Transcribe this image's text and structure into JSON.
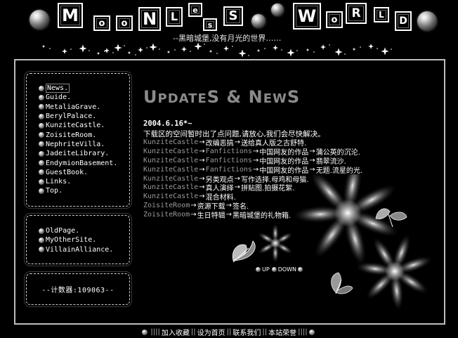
{
  "header": {
    "title_tiles": [
      "M",
      "o",
      "o",
      "N",
      "L",
      "e",
      "s",
      "S",
      "W",
      "o",
      "R",
      "L",
      "D"
    ],
    "tagline": "--黑暗城堡,没有月光的世界……"
  },
  "nav": {
    "items": [
      {
        "label": "News."
      },
      {
        "label": "Guide."
      },
      {
        "label": "MetaliaGrave."
      },
      {
        "label": "BerylPalace."
      },
      {
        "label": "KunziteCastle."
      },
      {
        "label": "ZoisiteRoom."
      },
      {
        "label": "NephriteVilla."
      },
      {
        "label": "JadeiteLibrary."
      },
      {
        "label": "EndymionBasement."
      },
      {
        "label": "GuestBook."
      },
      {
        "label": "Links."
      },
      {
        "label": "Top."
      }
    ],
    "secondary": [
      {
        "label": "OldPage."
      },
      {
        "label": "MyOtherSite."
      },
      {
        "label": "VillainAlliance."
      }
    ]
  },
  "counter": {
    "text": "--计数器:109063--"
  },
  "main": {
    "title_big_1": "U",
    "title_small_1": "PDATE",
    "title_big_2": "S & N",
    "title_small_2": "EW",
    "title_big_3": "S",
    "date": "2004.6.16*~",
    "note": "下载区的空间暂时出了点问题,请放心,我们会尽快解决。",
    "entries": [
      {
        "section": "KunziteCastle",
        "parts": [
          "改编恶搞",
          "送给真人版之古舒特."
        ]
      },
      {
        "section": "KunziteCastle",
        "parts": [
          "Fanfictions",
          "中国网友的作品",
          "蒲公英的沉沦."
        ]
      },
      {
        "section": "KunziteCastle",
        "parts": [
          "Fanfictions",
          "中国网友的作品",
          "翡翠流沙."
        ]
      },
      {
        "section": "KunziteCastle",
        "parts": [
          "Fanfictions",
          "中国网友的作品",
          "无题.流星的光."
        ]
      },
      {
        "section": "KunziteCastle",
        "parts": [
          "另类观点",
          "写作选择.母鸡和母猫."
        ]
      },
      {
        "section": "KunziteCastle",
        "parts": [
          "真人演绎",
          "拼贴图.拍摄花絮."
        ]
      },
      {
        "section": "KunziteCastle",
        "parts": [
          "混合材料."
        ]
      },
      {
        "section": "ZoisiteRoom",
        "parts": [
          "资源下载",
          "签名."
        ]
      },
      {
        "section": "ZoisiteRoom",
        "parts": [
          "生日特辑",
          "黑暗城堡的礼物箱."
        ]
      }
    ],
    "up_label": "UP",
    "down_label": "DOWN"
  },
  "footer": {
    "left_sep": "||||",
    "links": [
      "加入收藏",
      "设为首页",
      "联系我们",
      "本站荣誉"
    ],
    "right_sep": "||||"
  },
  "colors": {
    "background": "#000000",
    "title": "#8a8a8a",
    "text": "#ffffff",
    "dim": "#9a9a9a"
  }
}
